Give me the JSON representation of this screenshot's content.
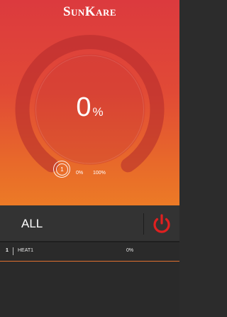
{
  "header": {
    "brand": "SunKare"
  },
  "gauge": {
    "value": "0",
    "unit": "%",
    "level_fraction": 0,
    "badge_number": "1",
    "scale_min": "0%",
    "scale_max": "100%"
  },
  "zone_bar": {
    "label": "ALL",
    "power_icon": "power-icon"
  },
  "zones": [
    {
      "index": "1",
      "name": "HEAT1",
      "value": "0%"
    }
  ],
  "colors": {
    "accent_red": "#e02020",
    "gradient_top": "#dc3a3e",
    "gradient_bottom": "#ec7a26",
    "row_underline": "#e0712f"
  }
}
